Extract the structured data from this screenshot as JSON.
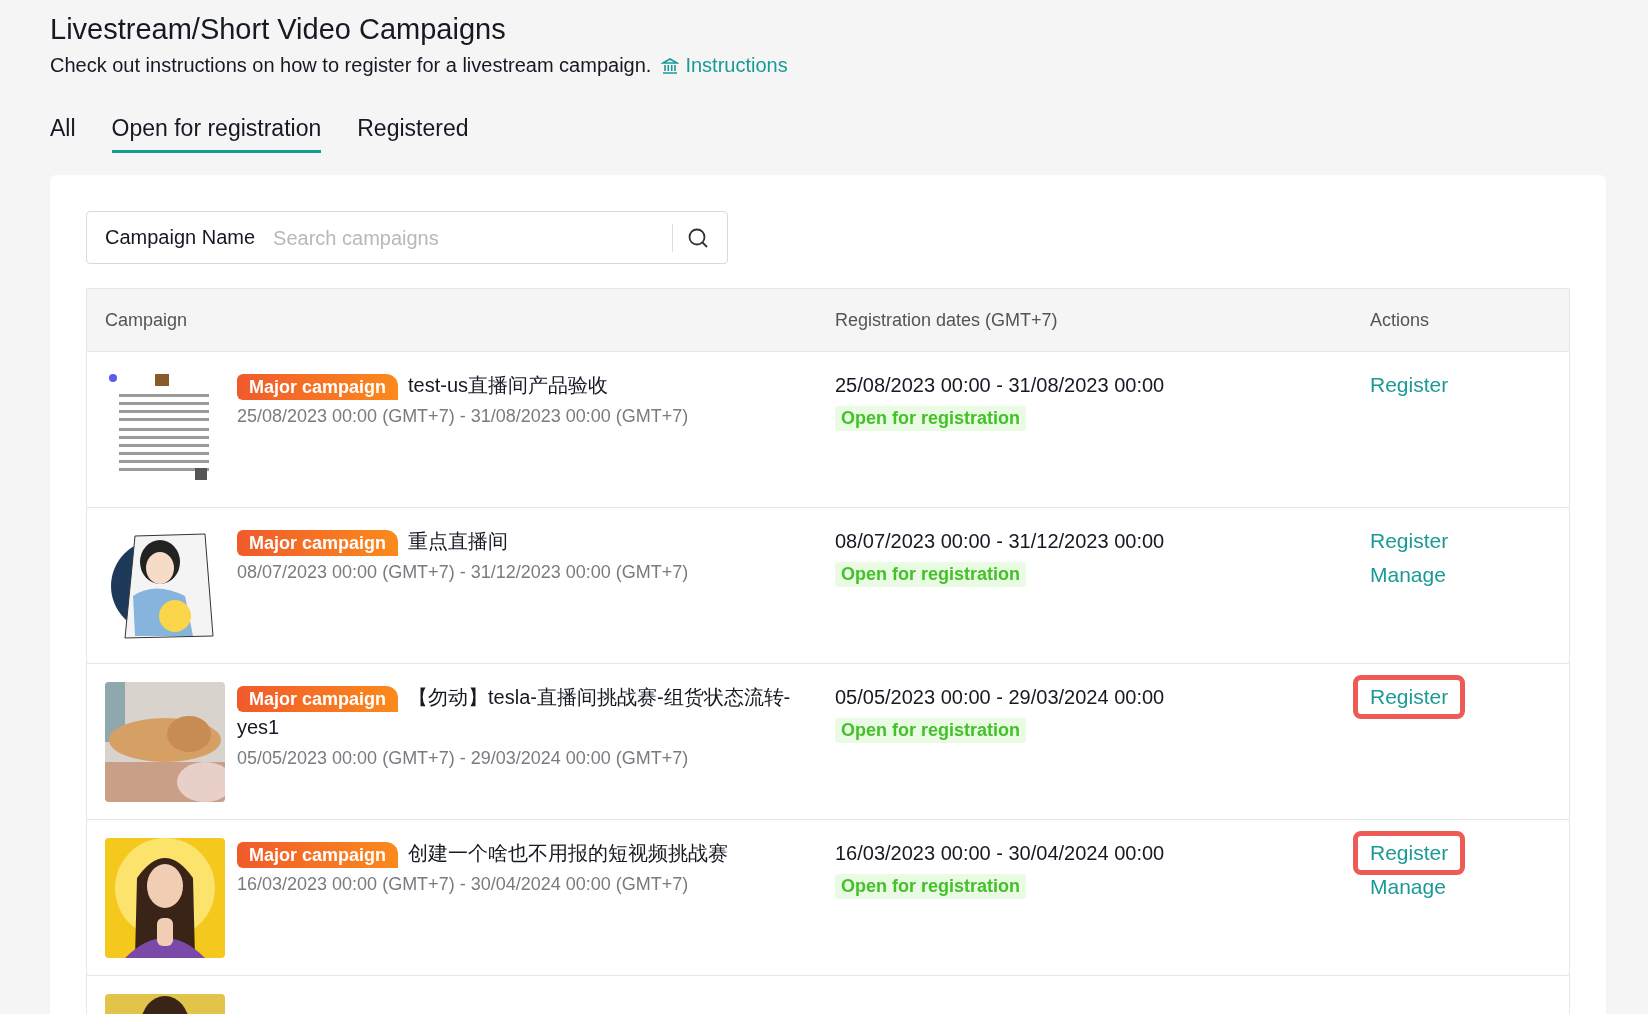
{
  "header": {
    "title": "Livestream/Short Video Campaigns",
    "subtitle": "Check out instructions on how to register for a livestream campaign.",
    "link": "Instructions"
  },
  "tabs": [
    {
      "label": "All",
      "selected": false
    },
    {
      "label": "Open for registration",
      "selected": true
    },
    {
      "label": "Registered",
      "selected": false
    }
  ],
  "search": {
    "label": "Campaign Name",
    "placeholder": "Search campaigns"
  },
  "table": {
    "columns": [
      "Campaign",
      "Registration dates (GMT+7)",
      "Actions"
    ],
    "rows": [
      {
        "thumbnail": {
          "kind": "picture"
        },
        "badge": "Major campaign",
        "name": "test-us直播间产品验收",
        "period": "25/08/2023 00:00 (GMT+7) - 31/08/2023 00:00 (GMT+7)",
        "dates": "25/08/2023 00:00 - 31/08/2023 00:00",
        "status": "Open for registration",
        "actions": [
          {
            "label": "Register",
            "highlighted": false
          }
        ]
      },
      {
        "thumbnail": {
          "kind": "picture"
        },
        "badge": "Major campaign",
        "name": "重点直播间",
        "period": "08/07/2023 00:00 (GMT+7) - 31/12/2023 00:00 (GMT+7)",
        "dates": "08/07/2023 00:00 - 31/12/2023 00:00",
        "status": "Open for registration",
        "actions": [
          {
            "label": "Register",
            "highlighted": false
          },
          {
            "label": "Manage",
            "highlighted": false
          }
        ]
      },
      {
        "thumbnail": {
          "kind": "picture"
        },
        "badge": "Major campaign",
        "name": "【勿动】tesla-直播间挑战赛-组货状态流转-yes1",
        "period": "05/05/2023 00:00 (GMT+7) - 29/03/2024 00:00 (GMT+7)",
        "dates": "05/05/2023 00:00 - 29/03/2024 00:00",
        "status": "Open for registration",
        "actions": [
          {
            "label": "Register",
            "highlighted": true
          }
        ]
      },
      {
        "thumbnail": {
          "kind": "picture"
        },
        "badge": "Major campaign",
        "name": "创建一个啥也不用报的短视频挑战赛",
        "period": "16/03/2023 00:00 (GMT+7) - 30/04/2024 00:00 (GMT+7)",
        "dates": "16/03/2023 00:00 - 30/04/2024 00:00",
        "status": "Open for registration",
        "actions": [
          {
            "label": "Register",
            "highlighted": true
          },
          {
            "label": "Manage",
            "highlighted": false
          }
        ]
      },
      {
        "thumbnail": {
          "kind": "picture"
        }
      }
    ]
  }
}
